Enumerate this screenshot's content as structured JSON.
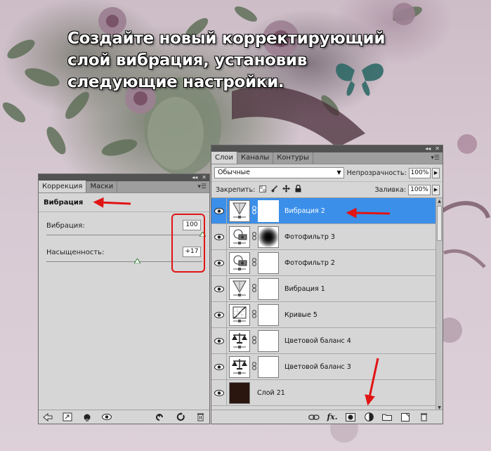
{
  "instruction": {
    "lines": [
      "Создайте новый корректирующий",
      "слой вибрация, установив",
      "следующие настройки."
    ]
  },
  "correction_panel": {
    "tabs": [
      "Коррекция",
      "Маски"
    ],
    "active_tab": "Коррекция",
    "title": "Вибрация",
    "sliders": [
      {
        "label": "Вибрация:",
        "value": "100",
        "min": -100,
        "max": 100,
        "level": 100
      },
      {
        "label": "Насыщенность:",
        "value": "+17",
        "min": -100,
        "max": 100,
        "level": 17
      }
    ],
    "bottom_icons": [
      "back-arrow-icon",
      "expand-view-icon",
      "clip-layer-icon",
      "visibility-eye-icon",
      "previous-state-icon",
      "reset-icon",
      "trash-icon"
    ]
  },
  "layers_panel": {
    "tabs": [
      "Слои",
      "Каналы",
      "Контуры"
    ],
    "active_tab": "Слои",
    "blend_mode": "Обычные",
    "opacity_label": "Непрозрачность:",
    "opacity_value": "100%",
    "lock_label": "Закрепить:",
    "fill_label": "Заливка:",
    "fill_value": "100%",
    "layers": [
      {
        "name": "Вибрация 2",
        "type": "vibrance",
        "selected": true,
        "mask": "white"
      },
      {
        "name": "Фотофильтр 3",
        "type": "photo-filter",
        "selected": false,
        "mask": "radial"
      },
      {
        "name": "Фотофильтр 2",
        "type": "photo-filter",
        "selected": false,
        "mask": "white"
      },
      {
        "name": "Вибрация 1",
        "type": "vibrance",
        "selected": false,
        "mask": "white"
      },
      {
        "name": "Кривые 5",
        "type": "curves",
        "selected": false,
        "mask": "white"
      },
      {
        "name": "Цветовой баланс 4",
        "type": "color-balance",
        "selected": false,
        "mask": "white"
      },
      {
        "name": "Цветовой баланс 3",
        "type": "color-balance",
        "selected": false,
        "mask": "white"
      },
      {
        "name": "Слой 21",
        "type": "pixel",
        "selected": false,
        "mask": "none"
      }
    ],
    "bottom_icons": [
      "link-layers-icon",
      "fx-icon",
      "add-mask-icon",
      "new-adjustment-layer-icon",
      "new-group-icon",
      "new-layer-icon",
      "delete-layer-icon"
    ]
  },
  "colors": {
    "panel_bg": "#d6d6d6",
    "selected_layer": "#3b8fe9",
    "annotation_red": "#e11414"
  }
}
